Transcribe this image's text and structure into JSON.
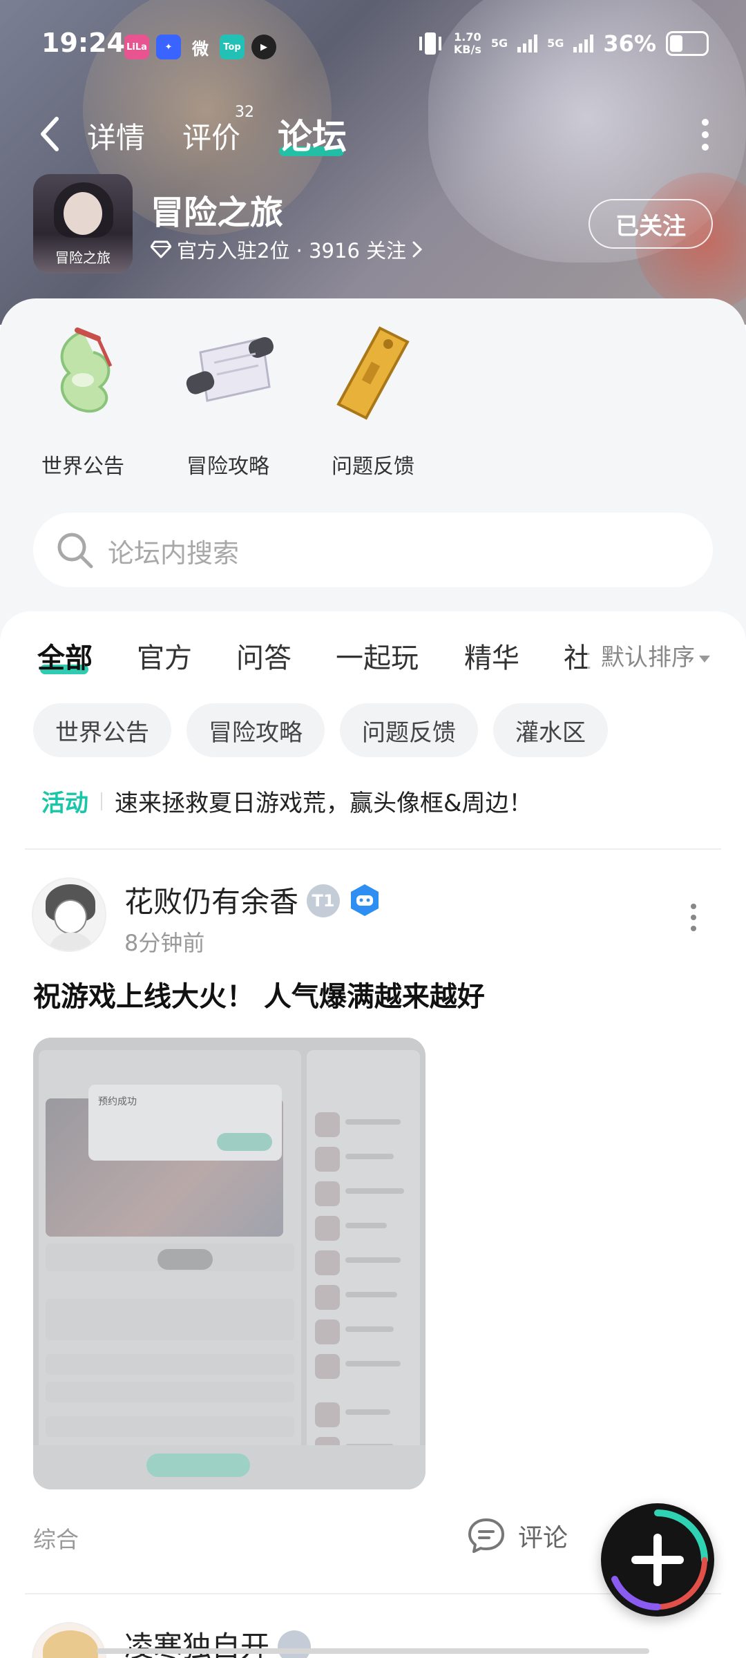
{
  "status_bar": {
    "time": "19:24",
    "apps": [
      {
        "name": "lofter-app-icon",
        "text": "LiLa",
        "color": "#e8548f"
      },
      {
        "name": "app-star-icon",
        "text": "✦",
        "color": "#3a64ff"
      },
      {
        "name": "weibo-icon",
        "text": "微",
        "color": "#222222"
      },
      {
        "name": "top-app-icon",
        "text": "Top",
        "color": "#23c1b5"
      },
      {
        "name": "play-app-icon",
        "text": "▶",
        "color": "#222222"
      }
    ],
    "net_speed": "1.70",
    "net_unit": "KB/s",
    "net_type_1": "5G",
    "net_type_2": "5G",
    "battery": "36%"
  },
  "nav": {
    "tabs": [
      {
        "label": "详情"
      },
      {
        "label": "评价",
        "badge": "32"
      },
      {
        "label": "论坛",
        "active": true
      }
    ]
  },
  "game": {
    "icon_text": "冒险之旅",
    "name": "冒险之旅",
    "meta": "官方入驻2位 · 3916 关注",
    "follow_label": "已关注"
  },
  "quick_links": [
    {
      "label": "世界公告",
      "icon": "jade-pendant-icon"
    },
    {
      "label": "冒险攻略",
      "icon": "scroll-icon"
    },
    {
      "label": "问题反馈",
      "icon": "wooden-plank-icon"
    }
  ],
  "search": {
    "placeholder": "论坛内搜索"
  },
  "categories": [
    "全部",
    "官方",
    "问答",
    "一起玩",
    "精华",
    "社"
  ],
  "sort": {
    "label": "默认排序"
  },
  "chips": [
    "世界公告",
    "冒险攻略",
    "问题反馈",
    "灌水区"
  ],
  "activity": {
    "tag": "活动",
    "text": "速来拯救夏日游戏荒，赢头像框&周边！"
  },
  "post": {
    "author": "花败仍有余香",
    "level_badge": "T1",
    "time": "8分钟前",
    "title": "祝游戏上线大火！ 人气爆满越来越好",
    "image_text": "预约成功",
    "tag": "综合",
    "comment_label": "评论"
  },
  "next_post": {
    "author": "凌寒独自开"
  },
  "colors": {
    "accent": "#18c6a8"
  }
}
